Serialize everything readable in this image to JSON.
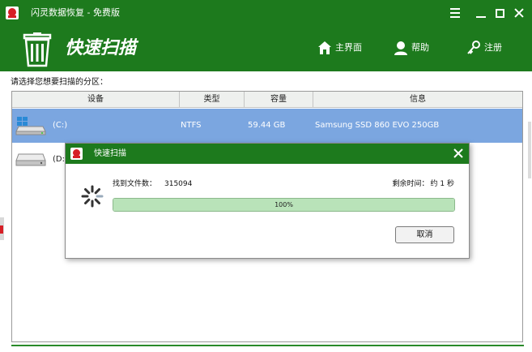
{
  "window": {
    "title": "闪灵数据恢复 - 免费版",
    "controls": [
      "menu-icon",
      "minimize-icon",
      "maximize-icon",
      "close-icon"
    ]
  },
  "header": {
    "title": "快速扫描",
    "nav": [
      {
        "label": "主界面",
        "icon": "home-icon"
      },
      {
        "label": "帮助",
        "icon": "user-help-icon"
      },
      {
        "label": "注册",
        "icon": "key-icon"
      }
    ]
  },
  "main": {
    "prompt": "请选择您想要扫描的分区：",
    "columns": [
      "设备",
      "类型",
      "容量",
      "信息"
    ],
    "rows": [
      {
        "name": "(C:)",
        "type": "NTFS",
        "capacity": "59.44 GB",
        "info": "Samsung SSD 860 EVO 250GB",
        "selected": true,
        "icon": "windows-drive-icon"
      },
      {
        "name": "(D:)",
        "type": "",
        "capacity": "",
        "info": "",
        "selected": false,
        "icon": "hard-drive-icon"
      }
    ]
  },
  "dialog": {
    "title": "快速扫描",
    "found_label": "找到文件数：",
    "found_count": "315094",
    "remaining_label": "剩余时间：",
    "remaining_value": "约 1 秒",
    "progress": 1.0,
    "progress_text": "100%",
    "cancel_label": "取消"
  },
  "colors": {
    "brand_green": "#1d7a1d",
    "selection_blue": "#7ba6e0",
    "progress_fill": "#b9e3b9",
    "logo_red": "#d61f26"
  }
}
